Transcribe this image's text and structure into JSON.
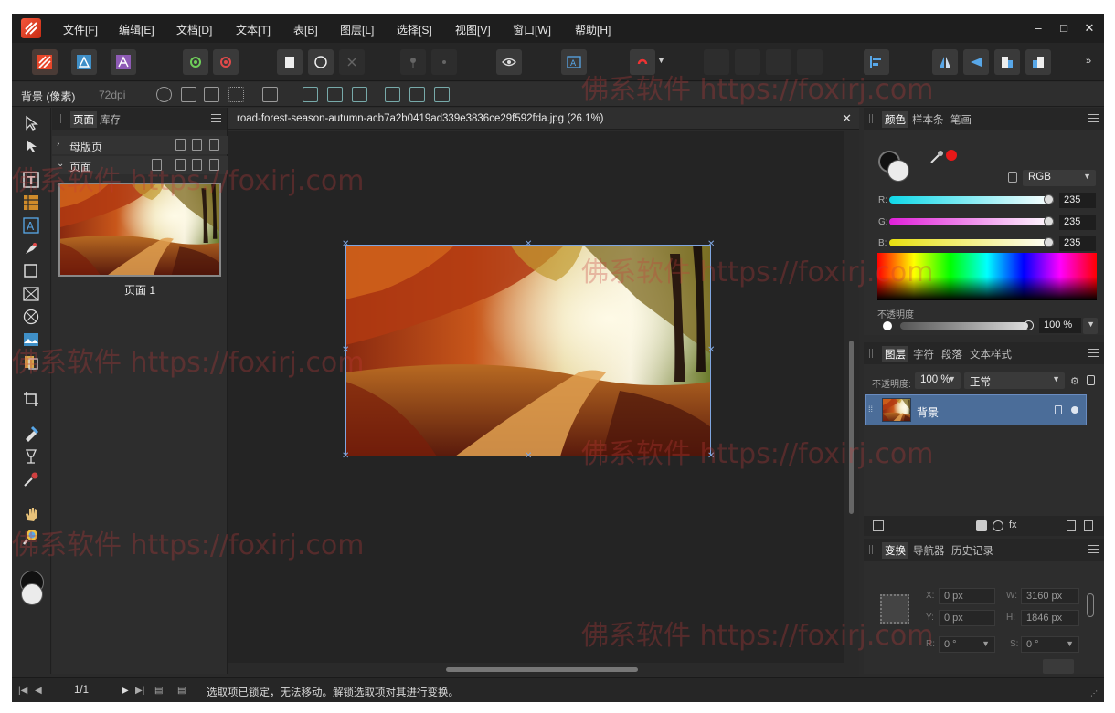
{
  "menu": [
    "文件[F]",
    "编辑[E]",
    "文档[D]",
    "文本[T]",
    "表[B]",
    "图层[L]",
    "选择[S]",
    "视图[V]",
    "窗口[W]",
    "帮助[H]"
  ],
  "window_controls": {
    "minimize": "–",
    "maximize": "□",
    "close": "✕"
  },
  "context": {
    "layer": "背景 (像素)",
    "dpi": "72dpi"
  },
  "pages_panel": {
    "tabs": [
      "页面",
      "库存"
    ],
    "master_pages": "母版页",
    "pages": "页面",
    "page_label": "页面 1"
  },
  "document": {
    "title": "road-forest-season-autumn-acb7a2b0419ad339e3836ce29f592fda.jpg (26.1%)"
  },
  "color_panel": {
    "tabs": [
      "颜色",
      "样本条",
      "笔画"
    ],
    "model": "RGB",
    "channels": [
      {
        "label": "R:",
        "value": "235"
      },
      {
        "label": "G:",
        "value": "235"
      },
      {
        "label": "B:",
        "value": "235"
      }
    ],
    "opacity_label": "不透明度",
    "opacity_value": "100 %"
  },
  "layers_panel": {
    "tabs": [
      "图层",
      "字符",
      "段落",
      "文本样式"
    ],
    "opacity_label": "不透明度:",
    "opacity_value": "100 %",
    "blend_mode": "正常",
    "layer_name": "背景"
  },
  "transform_panel": {
    "tabs": [
      "变换",
      "导航器",
      "历史记录"
    ],
    "x_label": "X:",
    "x_value": "0 px",
    "y_label": "Y:",
    "y_value": "0 px",
    "w_label": "W:",
    "w_value": "3160 px",
    "h_label": "H:",
    "h_value": "1846 px",
    "r_label": "R:",
    "r_value": "0 °",
    "s_label": "S:",
    "s_value": "0 °"
  },
  "status": {
    "page_count": "1/1",
    "message": "选取项已锁定，无法移动。解锁选取项对其进行变换。"
  },
  "watermark": "佛系软件 https://foxirj.com",
  "colors": {
    "accent": "#4b6d99",
    "brand": "#e8472a"
  }
}
